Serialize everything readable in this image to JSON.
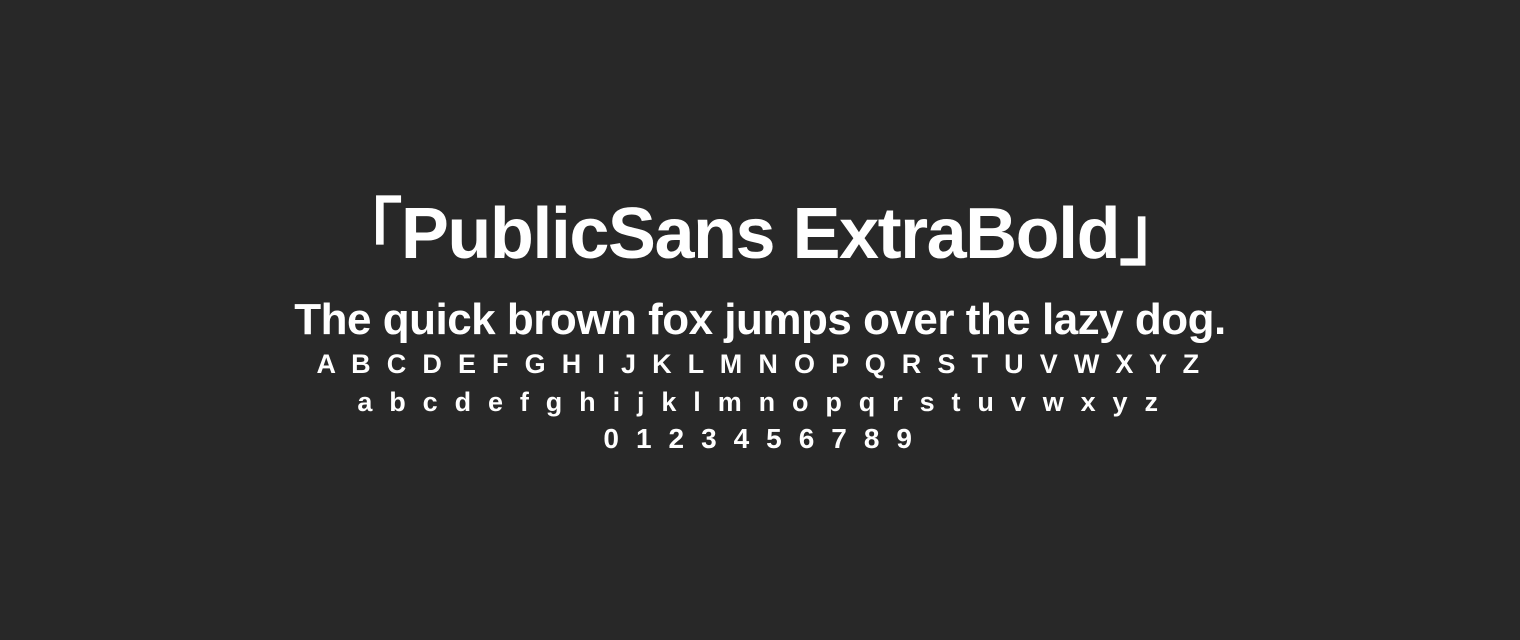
{
  "specimen": {
    "title": "「PublicSans ExtraBold」",
    "pangram": "The quick brown fox jumps over the lazy dog.",
    "uppercase": "A B C D E F G H I J K L M N O P Q R S T U V W X Y Z",
    "lowercase": "a b c d e f g h i j k l m n o p q r s t u v w x y z",
    "digits": "0 1 2 3 4 5 6 7 8 9"
  },
  "colors": {
    "background": "#282828",
    "text": "#ffffff"
  }
}
